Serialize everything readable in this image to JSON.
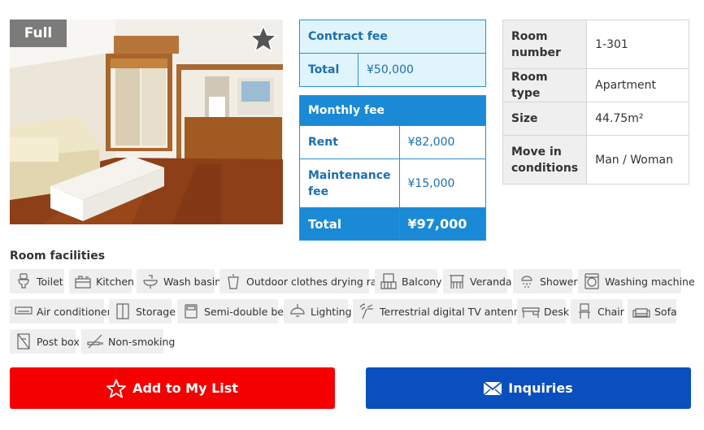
{
  "photo": {
    "badge": "Full"
  },
  "contract": {
    "title": "Contract fee",
    "total_label": "Total",
    "total_value": "¥50,000"
  },
  "monthly": {
    "title": "Monthly fee",
    "rent_label": "Rent",
    "rent_value": "¥82,000",
    "maintenance_label": "Maintenance fee",
    "maintenance_value": "¥15,000",
    "total_label": "Total",
    "total_value": "¥97,000"
  },
  "room": {
    "number_label": "Room number",
    "number_value": "1-301",
    "type_label": "Room type",
    "type_value": "Apartment",
    "size_label": "Size",
    "size_value": "44.75m²",
    "movein_label": "Move in conditions",
    "movein_value": "Man / Woman"
  },
  "facilities": {
    "title": "Room facilities",
    "items": [
      {
        "label": "Toilet",
        "icon": "toilet-icon"
      },
      {
        "label": "Kitchen",
        "icon": "kitchen-icon"
      },
      {
        "label": "Wash basin",
        "icon": "wash-basin-icon"
      },
      {
        "label": "Outdoor clothes drying rack",
        "icon": "drying-rack-icon"
      },
      {
        "label": "Balcony",
        "icon": "balcony-icon"
      },
      {
        "label": "Veranda",
        "icon": "veranda-icon"
      },
      {
        "label": "Shower",
        "icon": "shower-icon"
      },
      {
        "label": "Washing machine",
        "icon": "washing-machine-icon"
      },
      {
        "label": "Air conditioner",
        "icon": "air-conditioner-icon"
      },
      {
        "label": "Storage",
        "icon": "storage-icon"
      },
      {
        "label": "Semi-double bed",
        "icon": "bed-icon"
      },
      {
        "label": "Lighting",
        "icon": "lighting-icon"
      },
      {
        "label": "Terrestrial digital TV antenna",
        "icon": "antenna-icon"
      },
      {
        "label": "Desk",
        "icon": "desk-icon"
      },
      {
        "label": "Chair",
        "icon": "chair-icon"
      },
      {
        "label": "Sofa",
        "icon": "sofa-icon"
      },
      {
        "label": "Post box",
        "icon": "post-box-icon"
      },
      {
        "label": "Non-smoking",
        "icon": "non-smoking-icon"
      }
    ]
  },
  "actions": {
    "add_label": "Add to My List",
    "inquiries_label": "Inquiries"
  },
  "colors": {
    "add_button": "#f40000",
    "inquiries_button": "#0a4fbe",
    "monthly_header": "#1a8ad6",
    "contract_bg": "#dff4fb"
  }
}
